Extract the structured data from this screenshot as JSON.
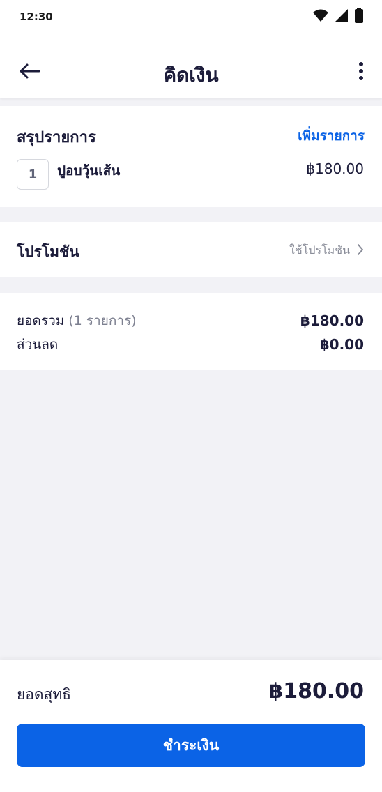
{
  "status_bar": {
    "time": "12:30",
    "icons": [
      "wifi-icon",
      "signal-icon",
      "battery-icon"
    ]
  },
  "header": {
    "title": "คิดเงิน",
    "back_icon": "arrow-left-icon",
    "menu_icon": "more-vertical-icon"
  },
  "summary": {
    "title": "สรุปรายการ",
    "add_label": "เพิ่มรายการ",
    "items": [
      {
        "qty": "1",
        "name": "ปูอบวุ้นเส้น",
        "price": "฿180.00"
      }
    ]
  },
  "promo": {
    "title": "โปรโมชัน",
    "link_label": "ใช้โปรโมชัน",
    "chevron_icon": "chevron-right-icon"
  },
  "totals": {
    "subtotal_label": "ยอดรวม",
    "subtotal_count": "(1 รายการ)",
    "subtotal_value": "฿180.00",
    "discount_label": "ส่วนลด",
    "discount_value": "฿0.00"
  },
  "footer": {
    "net_label": "ยอดสุทธิ",
    "net_value": "฿180.00",
    "pay_label": "ชำระเงิน"
  },
  "colors": {
    "accent": "#0b63e6",
    "text": "#1c1c3a",
    "muted": "#8a8d99",
    "background": "#f2f2f6"
  }
}
